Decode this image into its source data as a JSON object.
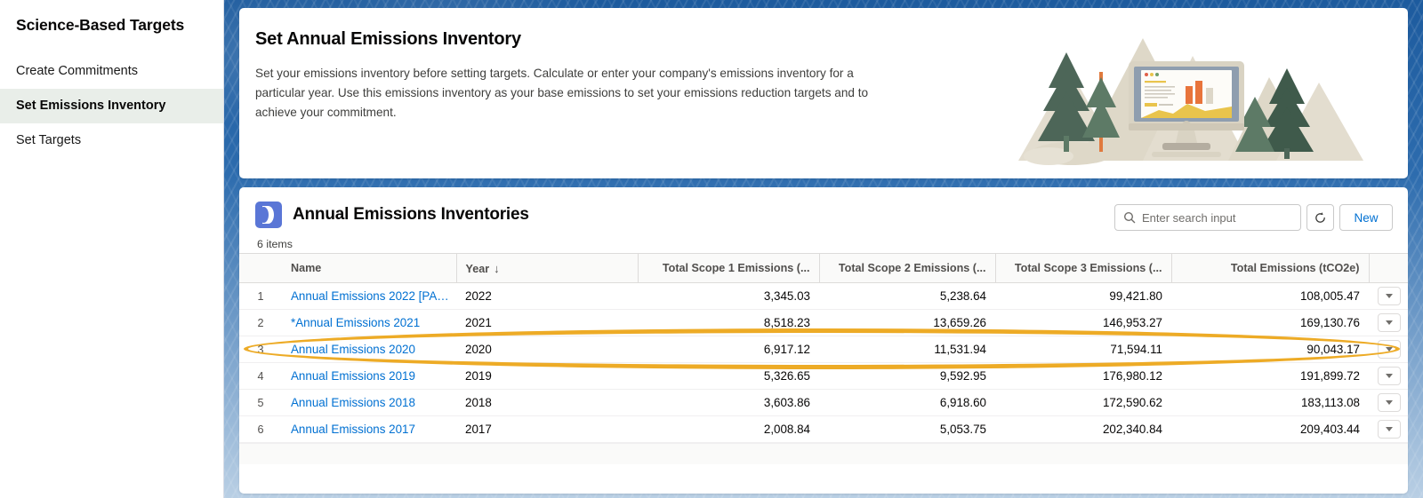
{
  "sidebar": {
    "title": "Science-Based Targets",
    "items": [
      {
        "label": "Create Commitments",
        "active": false
      },
      {
        "label": "Set Emissions Inventory",
        "active": true
      },
      {
        "label": "Set Targets",
        "active": false
      }
    ]
  },
  "header": {
    "title": "Set Annual Emissions Inventory",
    "description": "Set your emissions inventory before setting targets. Calculate or enter your company's emissions inventory for a particular year. Use this emissions inventory as your base emissions to set your emissions reduction targets and to achieve your commitment."
  },
  "list": {
    "icon_name": "moon-object-icon",
    "title": "Annual Emissions Inventories",
    "items_count": "6 items",
    "search": {
      "placeholder": "Enter search input",
      "value": "",
      "icon": "search-icon"
    },
    "refresh_label": "⟳",
    "refresh_icon": "refresh-icon",
    "new_label": "New",
    "accent_link_color": "#0070d2",
    "highlight_color": "#edab26"
  },
  "table": {
    "columns": [
      {
        "label": "Name",
        "align": "left",
        "sorted": false
      },
      {
        "label": "Year",
        "align": "left",
        "sorted": true,
        "sort_glyph": "↓"
      },
      {
        "label": "Total Scope 1 Emissions (...",
        "align": "right",
        "sorted": false
      },
      {
        "label": "Total Scope 2 Emissions (...",
        "align": "right",
        "sorted": false
      },
      {
        "label": "Total Scope 3 Emissions (...",
        "align": "right",
        "sorted": false
      },
      {
        "label": "Total Emissions (tCO2e)",
        "align": "right",
        "sorted": false
      }
    ],
    "rows": [
      {
        "index": "1",
        "name": "Annual Emissions 2022 [PA…",
        "year": "2022",
        "scope1": "3,345.03",
        "scope2": "5,238.64",
        "scope3": "99,421.80",
        "total": "108,005.47",
        "highlighted": false
      },
      {
        "index": "2",
        "name": "*Annual Emissions 2021",
        "year": "2021",
        "scope1": "8,518.23",
        "scope2": "13,659.26",
        "scope3": "146,953.27",
        "total": "169,130.76",
        "highlighted": true
      },
      {
        "index": "3",
        "name": "Annual Emissions 2020",
        "year": "2020",
        "scope1": "6,917.12",
        "scope2": "11,531.94",
        "scope3": "71,594.11",
        "total": "90,043.17",
        "highlighted": false
      },
      {
        "index": "4",
        "name": "Annual Emissions 2019",
        "year": "2019",
        "scope1": "5,326.65",
        "scope2": "9,592.95",
        "scope3": "176,980.12",
        "total": "191,899.72",
        "highlighted": false
      },
      {
        "index": "5",
        "name": "Annual Emissions 2018",
        "year": "2018",
        "scope1": "3,603.86",
        "scope2": "6,918.60",
        "scope3": "172,590.62",
        "total": "183,113.08",
        "highlighted": false
      },
      {
        "index": "6",
        "name": "Annual Emissions 2017",
        "year": "2017",
        "scope1": "2,008.84",
        "scope2": "5,053.75",
        "scope3": "202,340.84",
        "total": "209,403.44",
        "highlighted": false
      }
    ]
  },
  "illustration": {
    "name": "mountains-trees-monitor-illustration",
    "colors": {
      "mountain": "#ded8c8",
      "mountain_light": "#e9e4d7",
      "tree_dark": "#4a6355",
      "tree_mid": "#5d7a66",
      "monitor_frame": "#d9d3c3",
      "screen": "#9aa7b4",
      "bar_orange": "#e8743b",
      "area_yellow": "#e9c44c"
    }
  }
}
